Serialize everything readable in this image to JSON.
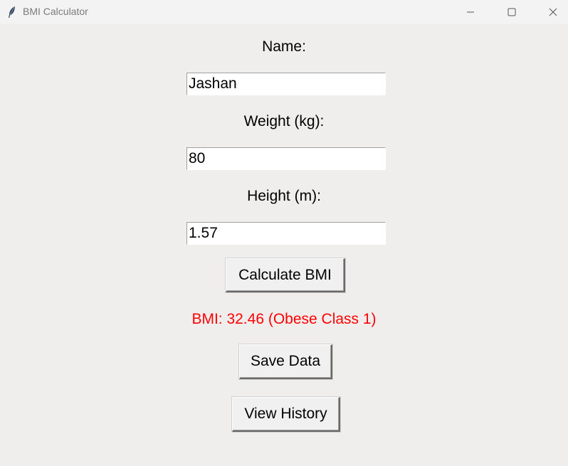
{
  "window": {
    "title": "BMI Calculator",
    "controls": {
      "minimize": "minimize-icon",
      "maximize": "maximize-icon",
      "close": "close-icon"
    }
  },
  "form": {
    "name_label": "Name:",
    "name_value": "Jashan",
    "weight_label": "Weight (kg):",
    "weight_value": "80",
    "height_label": "Height (m):",
    "height_value": "1.57"
  },
  "actions": {
    "calculate_label": "Calculate BMI",
    "save_label": "Save Data",
    "history_label": "View History"
  },
  "result": {
    "text": "BMI: 32.46 (Obese Class 1)",
    "color": "#ff0000"
  },
  "colors": {
    "background": "#f0eeed",
    "titlebar": "#f3f3f3"
  }
}
